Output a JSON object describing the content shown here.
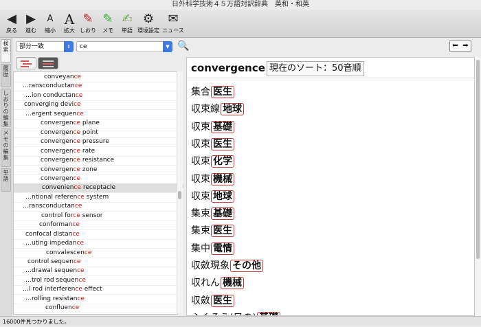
{
  "window": {
    "title": "日外科学技術４５万語対訳辞典　英和・和英"
  },
  "toolbar": [
    {
      "id": "back",
      "label": "戻る",
      "icon": "◀"
    },
    {
      "id": "forward",
      "label": "進む",
      "icon": "▶"
    },
    {
      "id": "shrink",
      "label": "縮小",
      "icon": "A"
    },
    {
      "id": "enlarge",
      "label": "拡大",
      "icon": "A"
    },
    {
      "id": "bookmark",
      "label": "しおり",
      "icon": "✎"
    },
    {
      "id": "memo",
      "label": "メモ",
      "icon": "✎"
    },
    {
      "id": "wordbook",
      "label": "単語",
      "icon": "✍"
    },
    {
      "id": "settings",
      "label": "環境設定",
      "icon": "⚙"
    },
    {
      "id": "news",
      "label": "ニュース",
      "icon": "✉"
    }
  ],
  "side_tabs": [
    {
      "label": "検索",
      "active": true
    },
    {
      "label": "履歴",
      "active": false
    },
    {
      "label": "しおりの編集",
      "active": false
    },
    {
      "label": "メモの編集",
      "active": false
    },
    {
      "label": "単語",
      "active": false
    }
  ],
  "search": {
    "mode": "部分一致",
    "query": "ce"
  },
  "results": [
    {
      "pre": "conveyan",
      "hl": "ce",
      "post": "",
      "indent": 44,
      "sel": false
    },
    {
      "pre": "…ransconductan",
      "hl": "ce",
      "post": "",
      "indent": 13,
      "sel": false
    },
    {
      "pre": "…ion conductan",
      "hl": "ce",
      "post": "",
      "indent": 17,
      "sel": false
    },
    {
      "pre": "converging devi",
      "hl": "ce",
      "post": "",
      "indent": 15,
      "sel": false
    },
    {
      "pre": "…ergent sequen",
      "hl": "ce",
      "post": "",
      "indent": 17,
      "sel": false
    },
    {
      "pre": "convergen",
      "hl": "ce",
      "post": " plane",
      "indent": 39,
      "sel": false
    },
    {
      "pre": "convergen",
      "hl": "ce",
      "post": " point",
      "indent": 39,
      "sel": false
    },
    {
      "pre": "convergen",
      "hl": "ce",
      "post": " pressure",
      "indent": 39,
      "sel": false
    },
    {
      "pre": "convergen",
      "hl": "ce",
      "post": " rate",
      "indent": 39,
      "sel": false
    },
    {
      "pre": "convergen",
      "hl": "ce",
      "post": " resistance",
      "indent": 39,
      "sel": false
    },
    {
      "pre": "convergen",
      "hl": "ce",
      "post": " zone",
      "indent": 39,
      "sel": false
    },
    {
      "pre": "convergen",
      "hl": "ce",
      "post": "",
      "indent": 39,
      "sel": false
    },
    {
      "pre": "convenien",
      "hl": "ce",
      "post": " receptacle",
      "indent": 41,
      "sel": true
    },
    {
      "pre": "…ntional referen",
      "hl": "ce",
      "post": " system",
      "indent": 17,
      "sel": false
    },
    {
      "pre": "…ransconductan",
      "hl": "ce",
      "post": "",
      "indent": 13,
      "sel": false
    },
    {
      "pre": "control for",
      "hl": "ce",
      "post": " sensor",
      "indent": 40,
      "sel": false
    },
    {
      "pre": "conforman",
      "hl": "ce",
      "post": "",
      "indent": 37,
      "sel": false
    },
    {
      "pre": "confocal distan",
      "hl": "ce",
      "post": "",
      "indent": 17,
      "sel": false
    },
    {
      "pre": "…uting impedan",
      "hl": "ce",
      "post": "",
      "indent": 17,
      "sel": false
    },
    {
      "pre": "convalescen",
      "hl": "ce",
      "post": "",
      "indent": 47,
      "sel": false
    },
    {
      "pre": "control sequen",
      "hl": "ce",
      "post": "",
      "indent": 20,
      "sel": false
    },
    {
      "pre": "…drawal sequen",
      "hl": "ce",
      "post": "",
      "indent": 17,
      "sel": false
    },
    {
      "pre": "…trol rod sequen",
      "hl": "ce",
      "post": "",
      "indent": 17,
      "sel": false
    },
    {
      "pre": "…l rod interferen",
      "hl": "ce",
      "post": " effect",
      "indent": 13,
      "sel": false
    },
    {
      "pre": "…rolling resistan",
      "hl": "ce",
      "post": "",
      "indent": 17,
      "sel": false
    },
    {
      "pre": "confluen",
      "hl": "ce",
      "post": "",
      "indent": 46,
      "sel": false
    }
  ],
  "detail": {
    "headword": "convergence",
    "sort_label": "現在のソート：50音順",
    "entries": [
      {
        "term": "集合",
        "field": "医生"
      },
      {
        "term": "収束線",
        "field": "地球"
      },
      {
        "term": "収束",
        "field": "基礎"
      },
      {
        "term": "収束",
        "field": "医生"
      },
      {
        "term": "収束",
        "field": "化学"
      },
      {
        "term": "収束",
        "field": "機械"
      },
      {
        "term": "収束",
        "field": "地球"
      },
      {
        "term": "集束",
        "field": "基礎"
      },
      {
        "term": "集束",
        "field": "医生"
      },
      {
        "term": "集中",
        "field": "電情"
      },
      {
        "term": "収斂現象",
        "field": "その他"
      },
      {
        "term": "収れん",
        "field": "機械"
      },
      {
        "term": "収斂",
        "field": "医生"
      },
      {
        "term": "ふくそう(目の)",
        "field": "基礎"
      }
    ]
  },
  "status": "16000件見つかりました。"
}
